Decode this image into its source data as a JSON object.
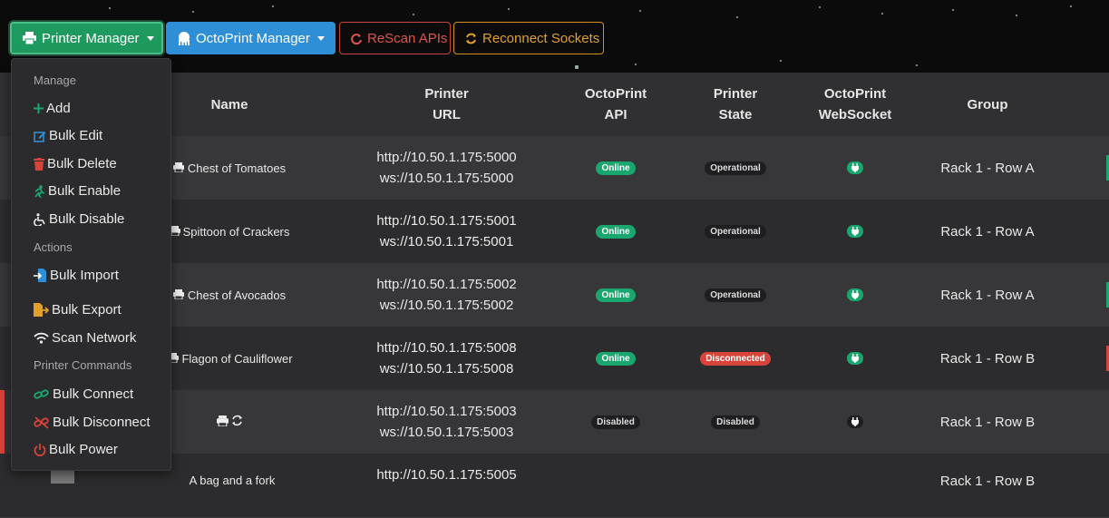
{
  "toolbar": {
    "printer_manager": "Printer Manager",
    "octoprint_manager": "OctoPrint Manager",
    "rescan_apis": "ReScan APIs",
    "reconnect_sockets": "Reconnect Sockets"
  },
  "table": {
    "headers": {
      "name": "Name",
      "printer_url_1": "Printer",
      "printer_url_2": "URL",
      "octoprint_api_1": "OctoPrint",
      "octoprint_api_2": "API",
      "printer_state_1": "Printer",
      "printer_state_2": "State",
      "websocket_1": "OctoPrint",
      "websocket_2": "WebSocket",
      "group": "Group"
    },
    "rows": [
      {
        "name": "Chest of Tomatoes",
        "http": "http://10.50.1.175:5000",
        "ws": "ws://10.50.1.175:5000",
        "api": "Online",
        "state": "Operational",
        "group": "Rack 1 - Row A"
      },
      {
        "name": "Spittoon of Crackers",
        "http": "http://10.50.1.175:5001",
        "ws": "ws://10.50.1.175:5001",
        "api": "Online",
        "state": "Operational",
        "group": "Rack 1 - Row A"
      },
      {
        "name": "Chest of Avocados",
        "http": "http://10.50.1.175:5002",
        "ws": "ws://10.50.1.175:5002",
        "api": "Online",
        "state": "Operational",
        "group": "Rack 1 - Row A"
      },
      {
        "name": "Flagon of Cauliflower",
        "http": "http://10.50.1.175:5008",
        "ws": "ws://10.50.1.175:5008",
        "api": "Online",
        "state": "Disconnected",
        "group": "Rack 1 - Row B"
      },
      {
        "name": "",
        "http": "http://10.50.1.175:5003",
        "ws": "ws://10.50.1.175:5003",
        "api": "Disabled",
        "state": "Disabled",
        "group": "Rack 1 - Row B"
      },
      {
        "name": "A bag and a fork",
        "http": "http://10.50.1.175:5005",
        "ws": "",
        "api": "",
        "state": "",
        "group": "Rack 1 - Row B"
      }
    ]
  },
  "dropdown": {
    "manage_header": "Manage",
    "add": "Add",
    "bulk_edit": "Bulk Edit",
    "bulk_delete": "Bulk Delete",
    "bulk_enable": "Bulk Enable",
    "bulk_disable": "Bulk Disable",
    "actions_header": "Actions",
    "bulk_import": "Bulk Import",
    "bulk_export": "Bulk Export",
    "scan_network": "Scan Network",
    "commands_header": "Printer Commands",
    "bulk_connect": "Bulk Connect",
    "bulk_disconnect": "Bulk Disconnect",
    "bulk_power": "Bulk Power"
  },
  "colors": {
    "success": "#1aa66f",
    "primary": "#2f8fd6",
    "danger": "#d8443a",
    "warning": "#e0a02a"
  }
}
